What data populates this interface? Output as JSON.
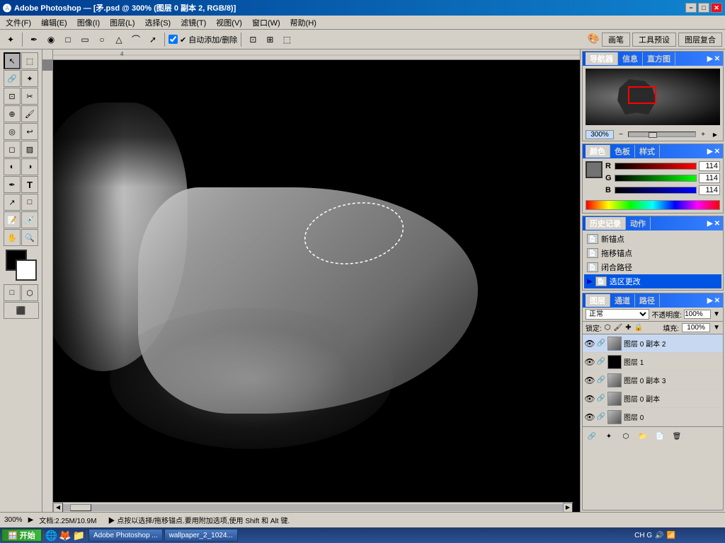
{
  "titleBar": {
    "title": "Adobe Photoshop — [矛.psd @ 300% (图层 0 副本 2, RGB/8)]",
    "logo": "Ps",
    "btns": {
      "min": "−",
      "max": "□",
      "close": "✕"
    }
  },
  "menuBar": {
    "items": [
      "文件(F)",
      "编辑(E)",
      "图像(I)",
      "图层(L)",
      "选择(S)",
      "滤镜(T)",
      "视图(V)",
      "窗口(W)",
      "帮助(H)"
    ]
  },
  "toolbar": {
    "autoAdd": "✔ 自动添加/删除"
  },
  "topPanels": {
    "btns": [
      "画笔",
      "工具预设",
      "图层复合"
    ]
  },
  "navigator": {
    "tab": "导航器",
    "tab2": "信息",
    "tab3": "直方图",
    "zoom": "300%"
  },
  "colorPanel": {
    "tab1": "颜色",
    "tab2": "色板",
    "tab3": "样式",
    "R": "114",
    "G": "114",
    "B": "114"
  },
  "historyPanel": {
    "tab1": "历史记录",
    "tab2": "动作",
    "items": [
      {
        "label": "新锚点",
        "active": false
      },
      {
        "label": "拖移锚点",
        "active": false
      },
      {
        "label": "闭合路径",
        "active": false
      },
      {
        "label": "选区更改",
        "active": true
      }
    ]
  },
  "layersPanel": {
    "tab1": "图层",
    "tab2": "通道",
    "tab3": "路径",
    "blendMode": "正常",
    "opacity": "100%",
    "fill": "100%",
    "lockLabel": "锁定:",
    "layers": [
      {
        "name": "图层 0 副本 2",
        "thumb": "gray",
        "visible": true
      },
      {
        "name": "图层 1",
        "thumb": "black",
        "visible": true
      },
      {
        "name": "图层 0 副本 3",
        "thumb": "gray",
        "visible": true
      },
      {
        "name": "图层 0 副本",
        "thumb": "gray",
        "visible": true
      },
      {
        "name": "图层 0",
        "thumb": "gray",
        "visible": true
      }
    ]
  },
  "statusBar": {
    "zoom": "300%",
    "docSize": "文档:2.25M/10.9M",
    "hint": "▶ 点按以选择/拖移锚点.要用附加选项,使用 Shift 和 Alt 键."
  },
  "taskbar": {
    "startLabel": "开始",
    "items": [
      "Adobe Photoshop ...",
      "wallpaper_2_1024..."
    ],
    "time": "CH G",
    "sysIcons": [
      "🔊",
      "📶"
    ]
  }
}
